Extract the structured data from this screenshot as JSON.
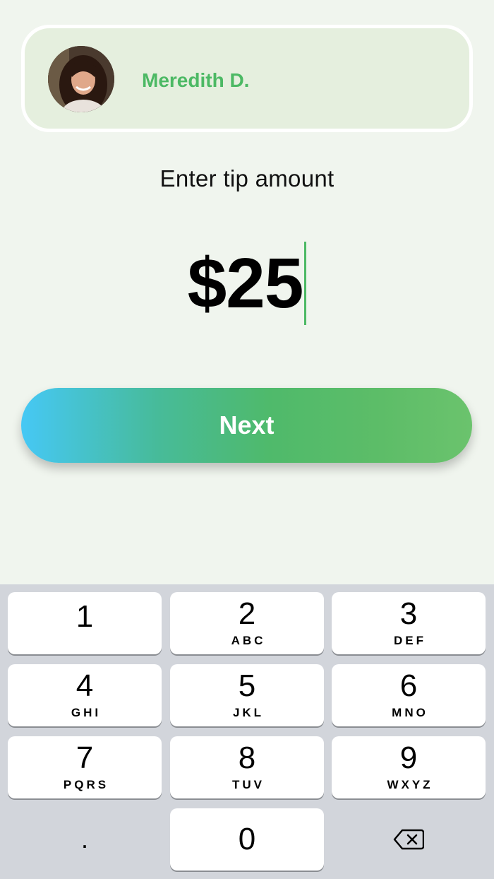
{
  "recipient": {
    "name": "Meredith D.",
    "avatar_icon": "profile-photo"
  },
  "prompt": "Enter tip amount",
  "amount": "$25",
  "next_button_label": "Next",
  "keypad": {
    "keys": [
      {
        "digit": "1",
        "letters": ""
      },
      {
        "digit": "2",
        "letters": "ABC"
      },
      {
        "digit": "3",
        "letters": "DEF"
      },
      {
        "digit": "4",
        "letters": "GHI"
      },
      {
        "digit": "5",
        "letters": "JKL"
      },
      {
        "digit": "6",
        "letters": "MNO"
      },
      {
        "digit": "7",
        "letters": "PQRS"
      },
      {
        "digit": "8",
        "letters": "TUV"
      },
      {
        "digit": "9",
        "letters": "WXYZ"
      }
    ],
    "decimal": ".",
    "zero": "0",
    "delete_icon": "backspace-icon"
  },
  "colors": {
    "accent_green": "#4cb964",
    "gradient_start": "#46c8f5",
    "gradient_end": "#6bc36d",
    "background": "#f0f5ee"
  }
}
